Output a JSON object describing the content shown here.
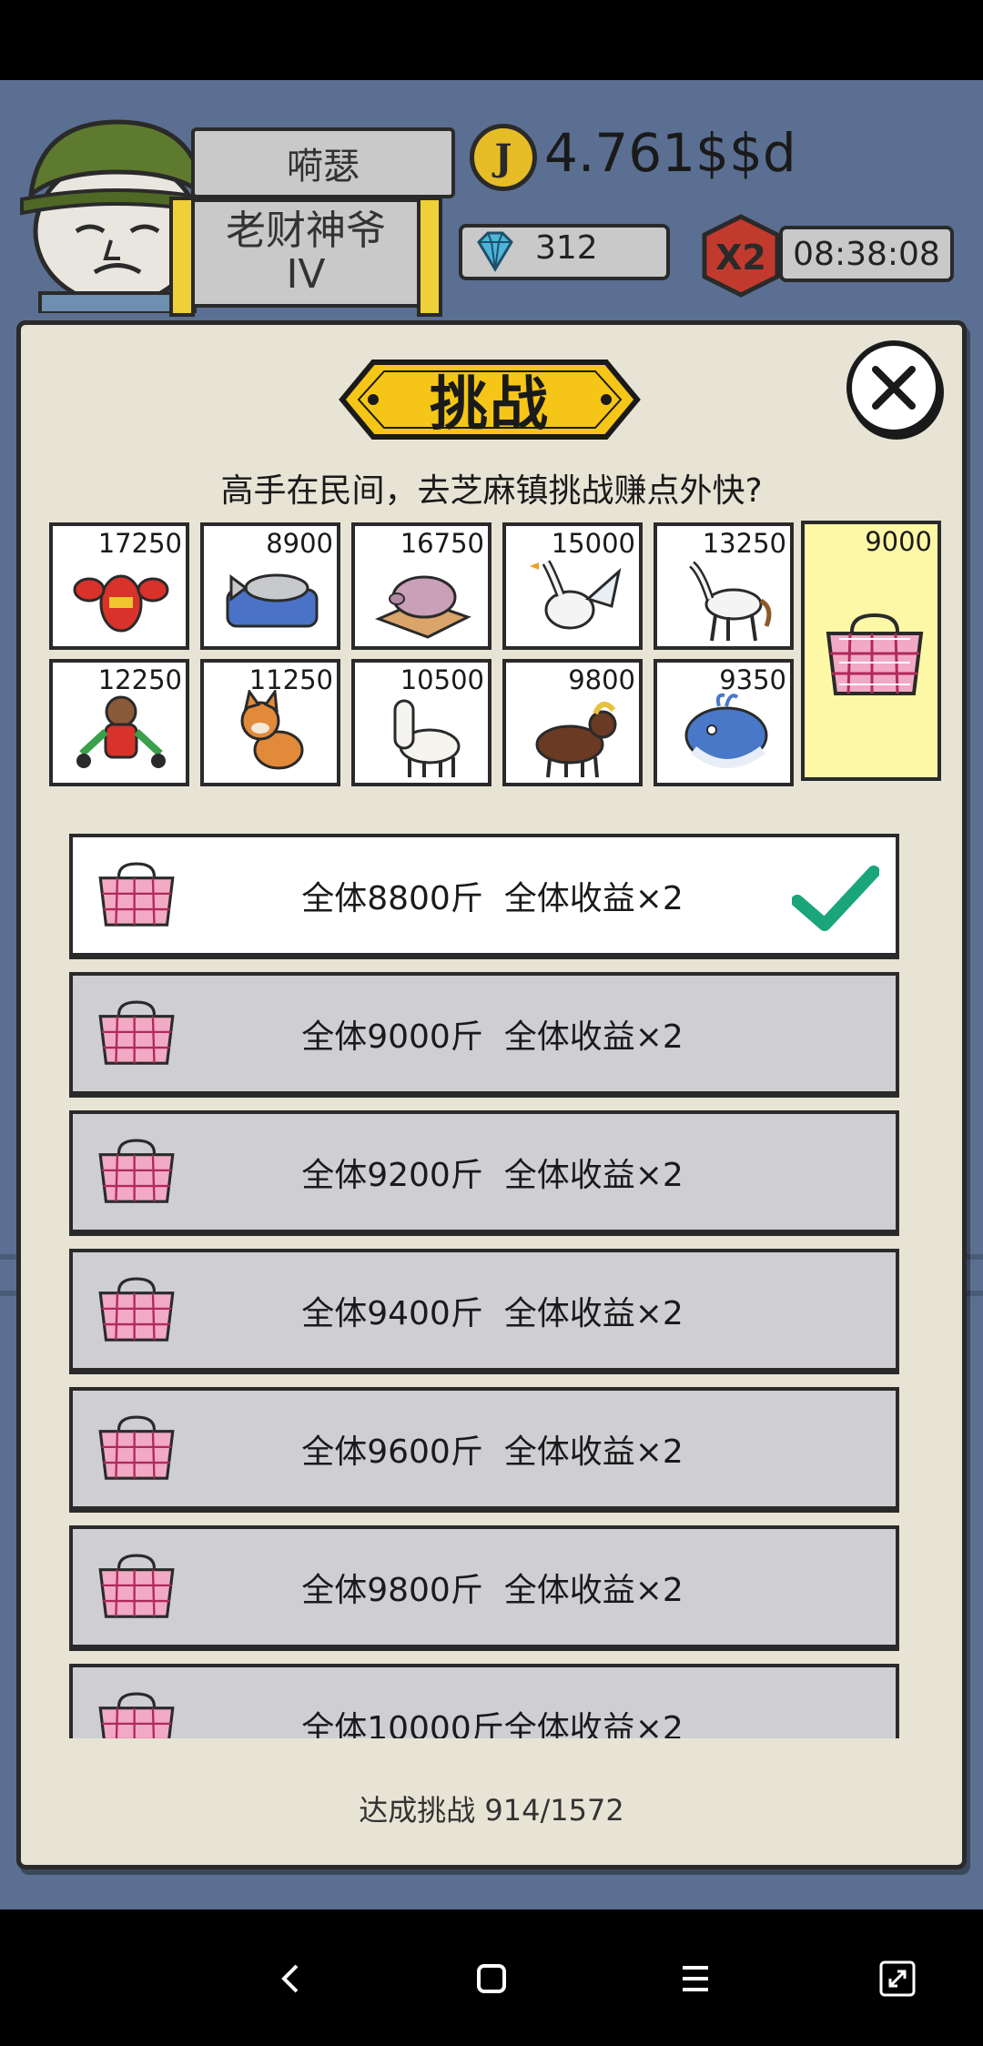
{
  "header": {
    "player_name": "嗬瑟",
    "title_line1": "老财神爷",
    "title_line2": "IV",
    "coin_symbol": "J",
    "coins": "4.761$$d",
    "gems": "312",
    "multiplier": "X2",
    "timer": "08:38:08"
  },
  "dialog": {
    "title": "挑战",
    "subtitle": "高手在民间，去芝麻镇挑战赚点外快?",
    "animals": [
      {
        "count": "17250",
        "icon": "lobster-icon"
      },
      {
        "count": "8900",
        "icon": "fish-on-sofa-icon"
      },
      {
        "count": "16750",
        "icon": "pig-icon"
      },
      {
        "count": "15000",
        "icon": "goose-icon"
      },
      {
        "count": "13250",
        "icon": "horse-icon"
      },
      {
        "count": "12250",
        "icon": "monkey-icon"
      },
      {
        "count": "11250",
        "icon": "shiba-dog-icon"
      },
      {
        "count": "10500",
        "icon": "alpaca-icon"
      },
      {
        "count": "9800",
        "icon": "yak-icon"
      },
      {
        "count": "9350",
        "icon": "whale-icon"
      }
    ],
    "selected": {
      "count": "9000",
      "icon": "plaid-bag-icon"
    },
    "challenges": [
      {
        "label": "全体8800斤  全体收益×2",
        "done": true
      },
      {
        "label": "全体9000斤  全体收益×2",
        "done": false
      },
      {
        "label": "全体9200斤  全体收益×2",
        "done": false
      },
      {
        "label": "全体9400斤  全体收益×2",
        "done": false
      },
      {
        "label": "全体9600斤  全体收益×2",
        "done": false
      },
      {
        "label": "全体9800斤  全体收益×2",
        "done": false
      },
      {
        "label": "全体10000斤全体收益×2",
        "done": false
      }
    ],
    "progress": "达成挑战 914/1572"
  },
  "colors": {
    "dialog_bg": "#e8e4d5",
    "row_inactive": "#cfcfd3",
    "row_active": "#ffffff",
    "selected_tile": "#fdf8a6",
    "check": "#1aa57a",
    "banner_yellow": "#f5c518",
    "badge_red": "#c23a2e"
  }
}
